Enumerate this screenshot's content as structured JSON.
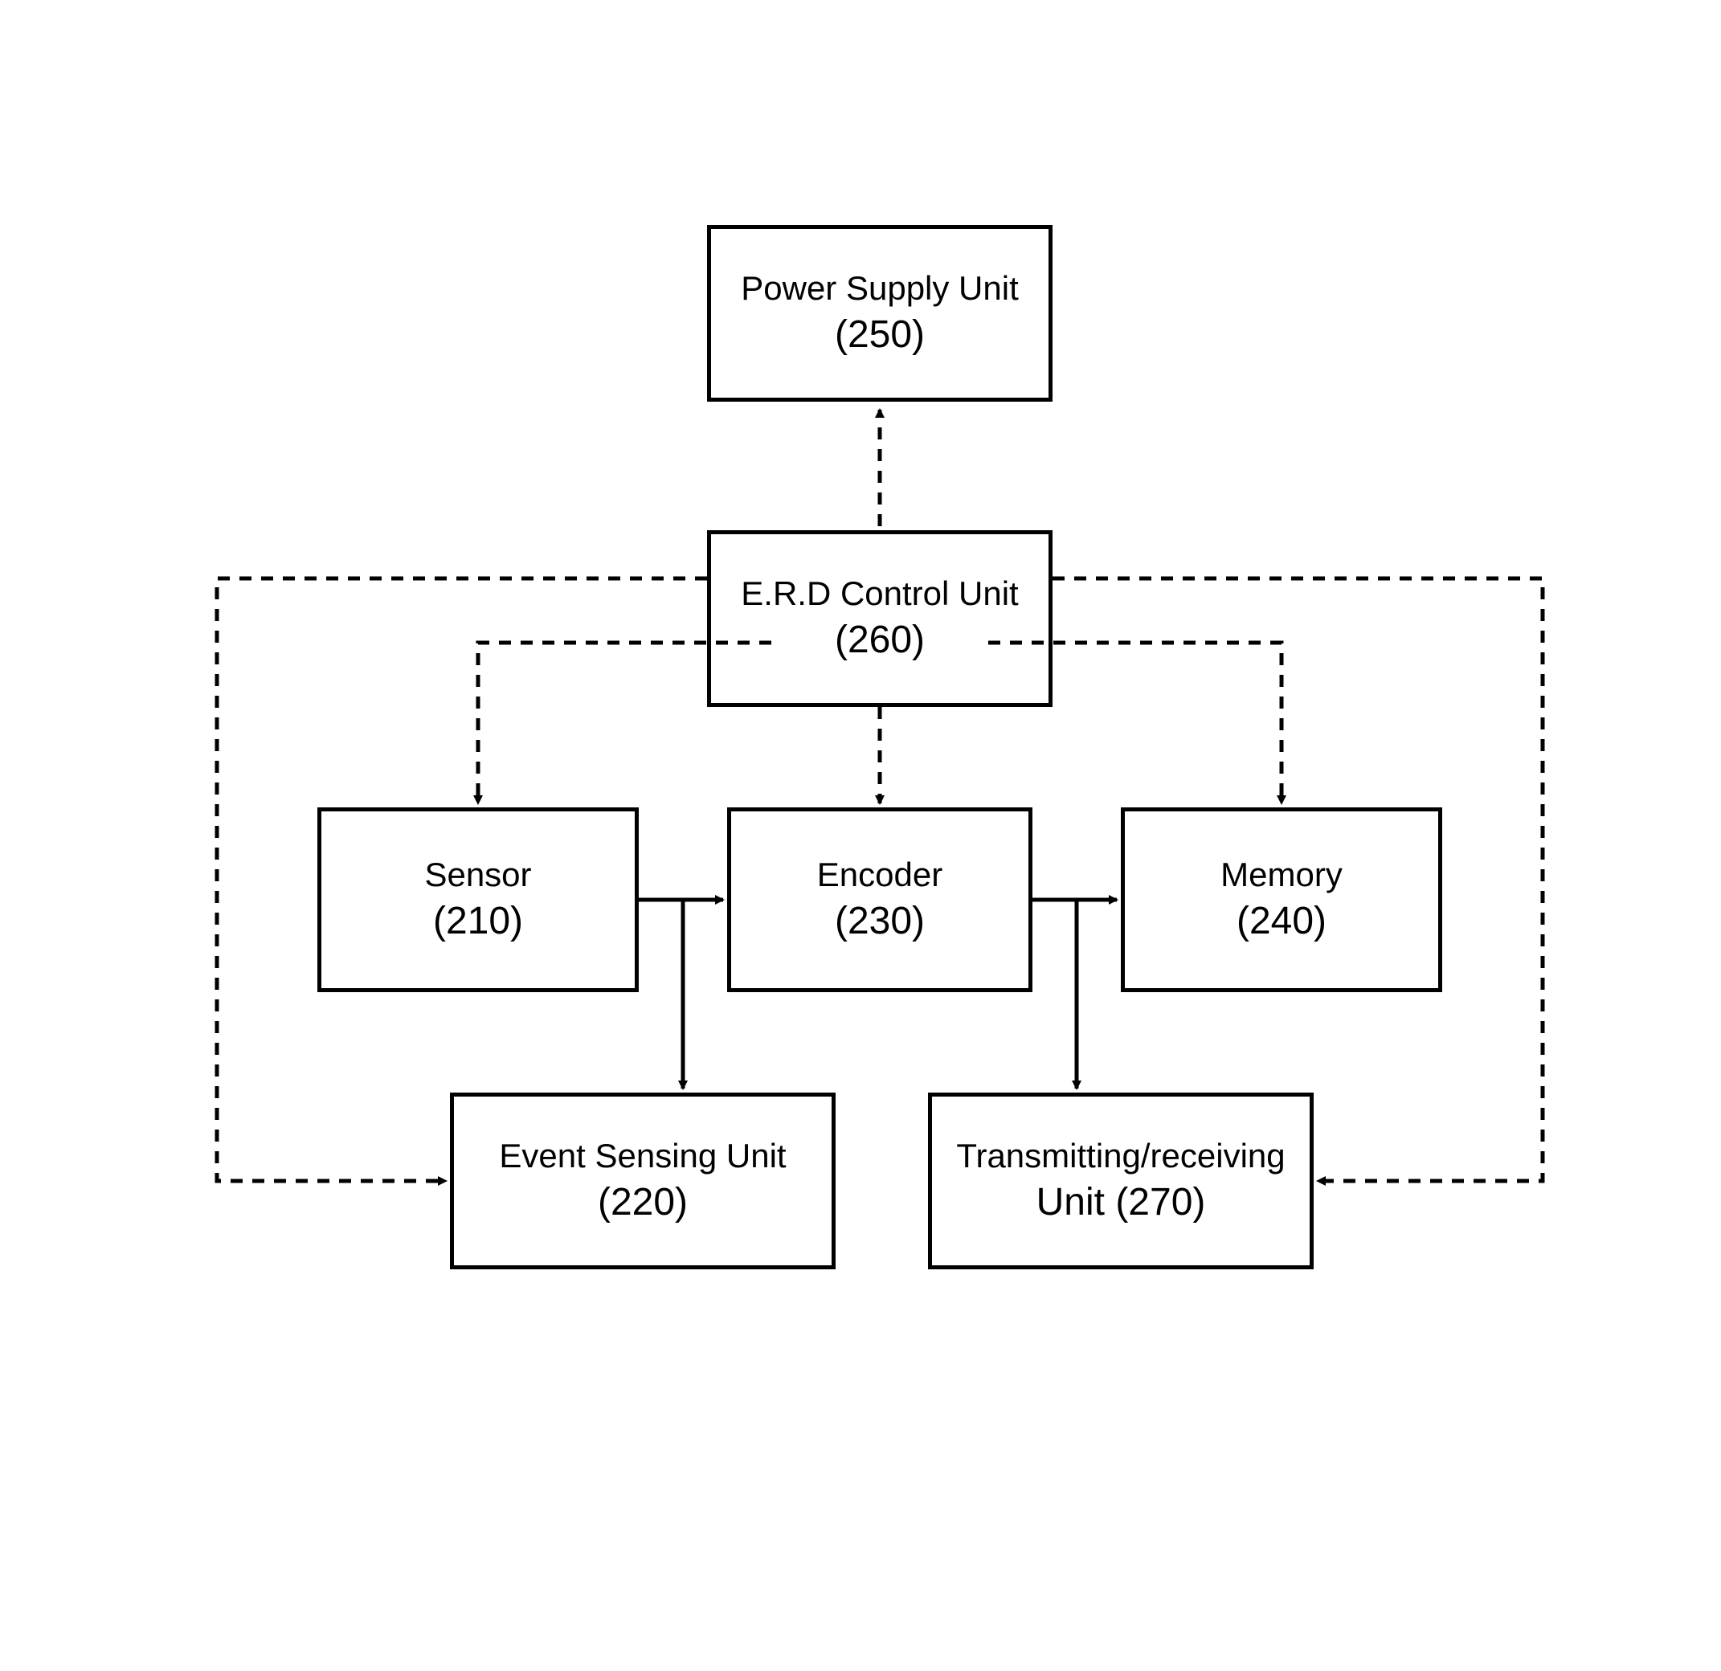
{
  "boxes": {
    "powerSupply": {
      "label": "Power Supply Unit",
      "number": "(250)"
    },
    "controlUnit": {
      "label": "E.R.D Control Unit",
      "number": "(260)"
    },
    "sensor": {
      "label": "Sensor",
      "number": "(210)"
    },
    "encoder": {
      "label": "Encoder",
      "number": "(230)"
    },
    "memory": {
      "label": "Memory",
      "number": "(240)"
    },
    "eventSensing": {
      "label": "Event Sensing Unit",
      "number": "(220)"
    },
    "transmitting": {
      "label": "Transmitting/receiving",
      "number": "Unit (270)"
    }
  }
}
